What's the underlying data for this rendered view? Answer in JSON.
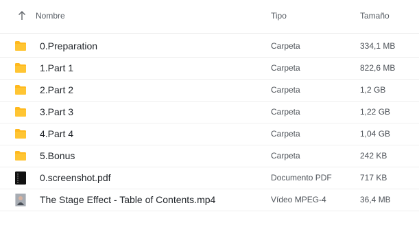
{
  "header": {
    "name_label": "Nombre",
    "type_label": "Tipo",
    "size_label": "Tamaño",
    "sort_icon": "arrow-up-icon"
  },
  "colors": {
    "folder": "#FFB91E",
    "row_divider": "#efefef",
    "text": "#1f2328",
    "muted": "#4d5258"
  },
  "files": [
    {
      "icon": "folder-icon",
      "name": "0.Preparation",
      "type": "Carpeta",
      "size": "334,1 MB"
    },
    {
      "icon": "folder-icon",
      "name": "1.Part 1",
      "type": "Carpeta",
      "size": "822,6 MB"
    },
    {
      "icon": "folder-icon",
      "name": "2.Part 2",
      "type": "Carpeta",
      "size": "1,2 GB"
    },
    {
      "icon": "folder-icon",
      "name": "3.Part 3",
      "type": "Carpeta",
      "size": "1,22 GB"
    },
    {
      "icon": "folder-icon",
      "name": "4.Part 4",
      "type": "Carpeta",
      "size": "1,04 GB"
    },
    {
      "icon": "folder-icon",
      "name": "5.Bonus",
      "type": "Carpeta",
      "size": "242 KB"
    },
    {
      "icon": "pdf-thumbnail-icon",
      "name": "0.screenshot.pdf",
      "type": "Documento PDF",
      "size": "717 KB"
    },
    {
      "icon": "video-thumbnail-icon",
      "name": "The Stage Effect - Table of Contents.mp4",
      "type": "Vídeo MPEG-4",
      "size": "36,4 MB"
    }
  ]
}
